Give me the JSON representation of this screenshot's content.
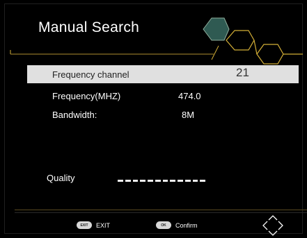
{
  "header": {
    "title": "Manual Search"
  },
  "rows": [
    {
      "label": "Frequency channel",
      "value": "21",
      "selected": true
    },
    {
      "label": "Frequency(MHZ)",
      "value": "474.0",
      "selected": false
    },
    {
      "label": "Bandwidth:",
      "value": "8M",
      "selected": false
    }
  ],
  "quality": {
    "label": "Quality",
    "level_percent": 100
  },
  "footer": {
    "exit": {
      "key": "EXIT",
      "label": "EXIT"
    },
    "confirm": {
      "key": "OK",
      "label": "Confirm"
    },
    "nav_icon": "dpad-arrows-icon"
  },
  "colors": {
    "background": "#000000",
    "selected_row": "#e0e0e0",
    "accent": "#c8a432",
    "hex_fill": "#2f5a52"
  }
}
